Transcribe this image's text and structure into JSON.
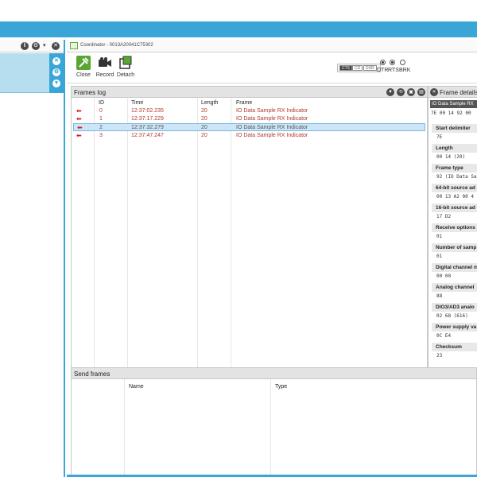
{
  "left_panel": {
    "header_icons": [
      "pause-icon",
      "settings-icon",
      "chevron-down-icon",
      "close-icon"
    ],
    "device_card_icons": [
      "close-icon",
      "settings-icon",
      "arrow-icon"
    ]
  },
  "tab": {
    "title": "Coordinator - 0013A20041C75302"
  },
  "toolbar": {
    "close_label": "Close",
    "record_label": "Record",
    "detach_label": "Detach",
    "serial_lines": [
      "CTS",
      "CD",
      "DSR"
    ],
    "control_lines": [
      "DTR",
      "RTS",
      "BRK"
    ],
    "control_states": [
      true,
      true,
      false
    ]
  },
  "frames_log": {
    "title": "Frames log",
    "columns": [
      "ID",
      "Time",
      "Length",
      "Frame"
    ],
    "rows": [
      {
        "id": "0",
        "time": "12:37:02.235",
        "length": "20",
        "frame": "IO Data Sample RX Indicator"
      },
      {
        "id": "1",
        "time": "12:37:17.229",
        "length": "20",
        "frame": "IO Data Sample RX Indicator"
      },
      {
        "id": "2",
        "time": "12:37:32.279",
        "length": "20",
        "frame": "IO Data Sample RX Indicator"
      },
      {
        "id": "3",
        "time": "12:37:47.247",
        "length": "20",
        "frame": "IO Data Sample RX Indicator"
      }
    ],
    "selected_index": 2
  },
  "frame_details": {
    "title": "Frame details",
    "type_label": "IO Data Sample RX",
    "hex": "7E 00 14 92 00",
    "fields": [
      {
        "label": "Start delimiter",
        "value": "7E"
      },
      {
        "label": "Length",
        "value": "00 14 (20)"
      },
      {
        "label": "Frame type",
        "value": "92 (IO Data Sa"
      },
      {
        "label": "64-bit source ad",
        "value": "00 13 A2 00 4"
      },
      {
        "label": "16-bit source ad",
        "value": "17 D2"
      },
      {
        "label": "Receive options",
        "value": "01"
      },
      {
        "label": "Number of samp",
        "value": "01"
      },
      {
        "label": "Digital channel m",
        "value": "00 00"
      },
      {
        "label": "Analog channel",
        "value": "88"
      },
      {
        "label": "DIO3/AD3 analo",
        "value": "02 68 (616)"
      },
      {
        "label": "Power supply va",
        "value": "0C E4"
      },
      {
        "label": "Checksum",
        "value": "23"
      }
    ]
  },
  "send_frames": {
    "title": "Send frames",
    "columns": [
      "Name",
      "Type"
    ]
  }
}
